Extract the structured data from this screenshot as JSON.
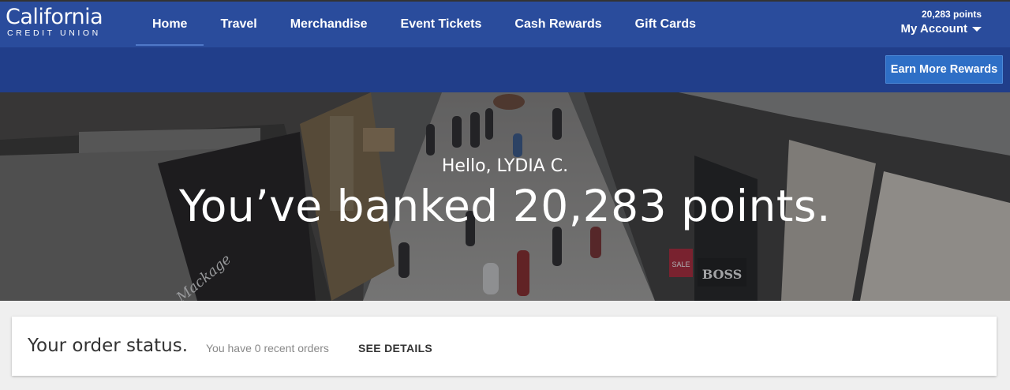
{
  "brand": {
    "name": "California",
    "sub": "CREDIT UNION"
  },
  "nav": {
    "items": [
      {
        "label": "Home",
        "active": true
      },
      {
        "label": "Travel"
      },
      {
        "label": "Merchandise"
      },
      {
        "label": "Event Tickets"
      },
      {
        "label": "Cash Rewards"
      },
      {
        "label": "Gift Cards"
      }
    ]
  },
  "account": {
    "points": "20,283 points",
    "label": "My Account"
  },
  "subbar": {
    "earn_label": "Earn More Rewards"
  },
  "hero": {
    "greeting": "Hello, LYDIA C.",
    "headline": "You’ve banked 20,283 points.",
    "signs": {
      "left": "Mackage",
      "right": "BOSS",
      "sale": "SALE"
    }
  },
  "order_status": {
    "title": "Your order status.",
    "recent": "You have 0 recent orders",
    "details_label": "SEE DETAILS"
  },
  "colors": {
    "nav_bg": "#2a4c9c",
    "subbar_bg": "#213e8a",
    "button_bg": "#2e6fc6"
  }
}
